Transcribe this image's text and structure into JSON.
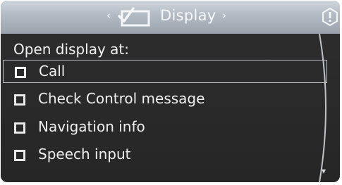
{
  "header": {
    "nav_left": "‹",
    "title": "Display",
    "nav_right": "›",
    "display_icon": "display-check-icon",
    "info_icon": "info-icon"
  },
  "subtitle": "Open display at:",
  "items": [
    {
      "label": "Call",
      "checked": false,
      "selected": true
    },
    {
      "label": "Check Control message",
      "checked": false,
      "selected": false
    },
    {
      "label": "Navigation info",
      "checked": false,
      "selected": false
    },
    {
      "label": "Speech input",
      "checked": false,
      "selected": false
    }
  ],
  "scroll": {
    "arrow": "▾"
  },
  "colors": {
    "header": "#b4bcc5",
    "background": "#2a2a2a",
    "text": "#efefef"
  }
}
